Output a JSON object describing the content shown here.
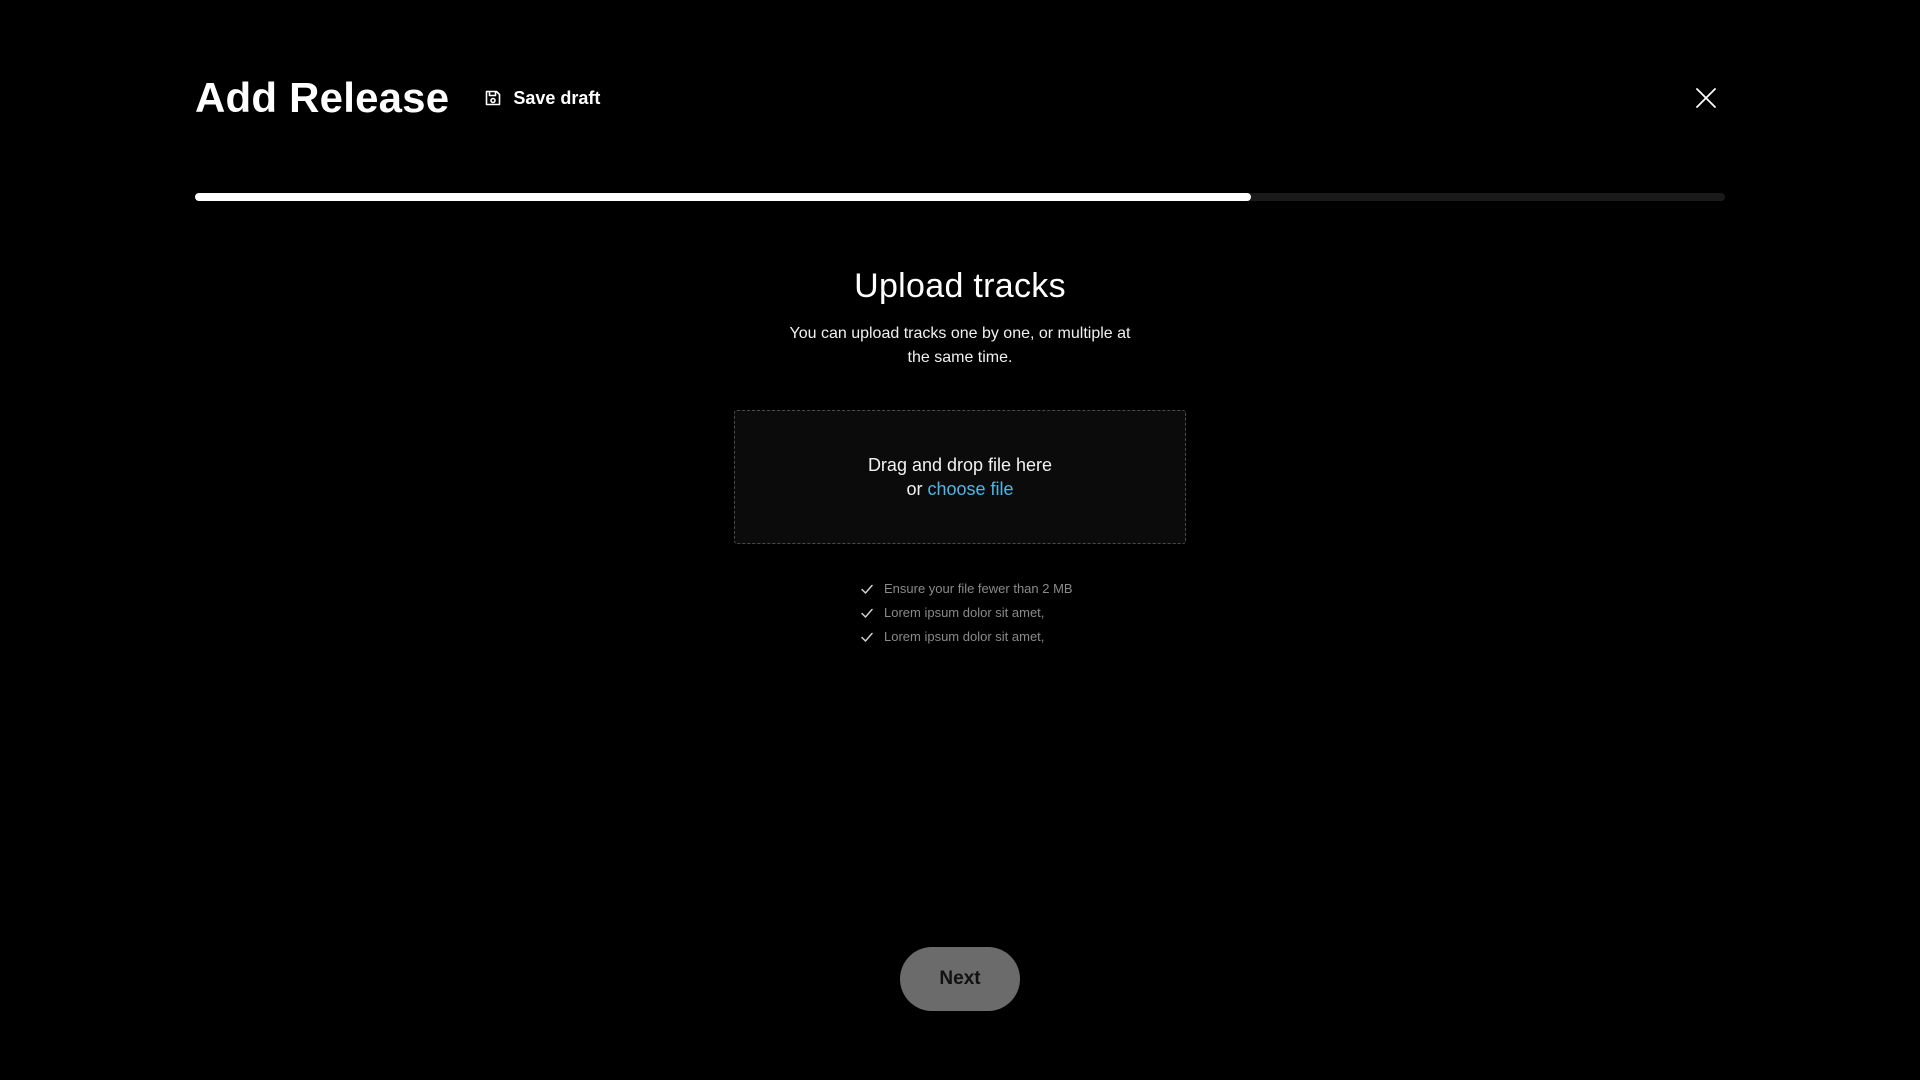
{
  "header": {
    "title": "Add Release",
    "save_draft_label": "Save draft",
    "save_icon": "save-icon",
    "close_icon": "close-icon"
  },
  "progress": {
    "fraction": 0.69
  },
  "upload": {
    "title": "Upload tracks",
    "subtitle": "You can upload tracks one by one, or multiple at the same time.",
    "dropzone_line1": "Drag and drop file here",
    "dropzone_or": "or ",
    "choose_file_label": "choose file",
    "link_color": "#4fb6e8"
  },
  "requirements": [
    "Ensure your file fewer than 2 MB",
    "Lorem ipsum dolor sit amet,",
    "Lorem ipsum dolor sit amet,"
  ],
  "footer": {
    "next_label": "Next",
    "next_button_color": "#6b6b6b"
  }
}
